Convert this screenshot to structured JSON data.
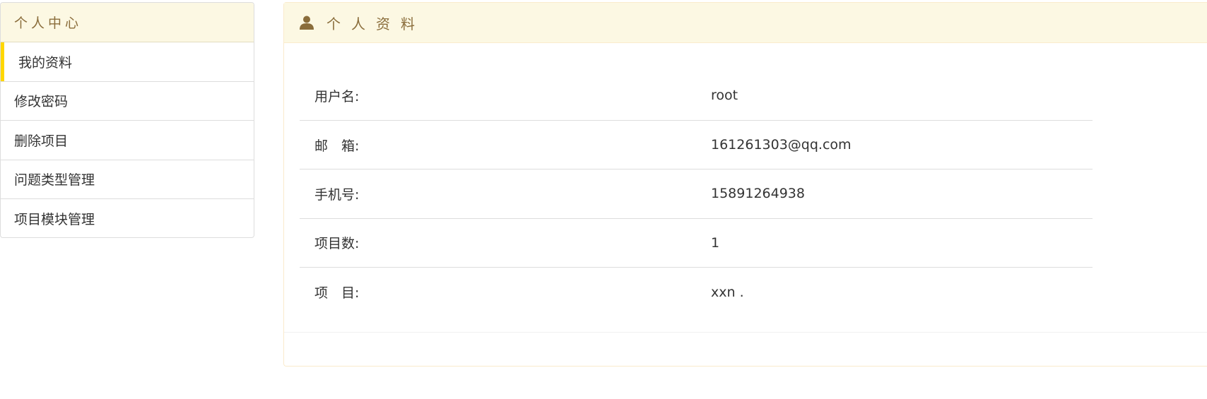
{
  "sidebar": {
    "title": "个人中心",
    "items": [
      {
        "label": "我的资料",
        "active": true
      },
      {
        "label": "修改密码",
        "active": false
      },
      {
        "label": "删除项目",
        "active": false
      },
      {
        "label": "问题类型管理",
        "active": false
      },
      {
        "label": "项目模块管理",
        "active": false
      }
    ]
  },
  "panel": {
    "icon": "user-icon",
    "title": "个人资料",
    "rows": [
      {
        "label": "用户名:",
        "value": "root"
      },
      {
        "label": "邮　箱:",
        "value": "161261303@qq.com"
      },
      {
        "label": "手机号:",
        "value": "15891264938"
      },
      {
        "label": "项目数:",
        "value": "1"
      },
      {
        "label": "项　目:",
        "value": "xxn ."
      }
    ]
  },
  "colors": {
    "header_bg": "#fcf8e3",
    "header_text": "#8a6d3b",
    "active_indicator": "#ffd700",
    "border": "#dddddd"
  }
}
